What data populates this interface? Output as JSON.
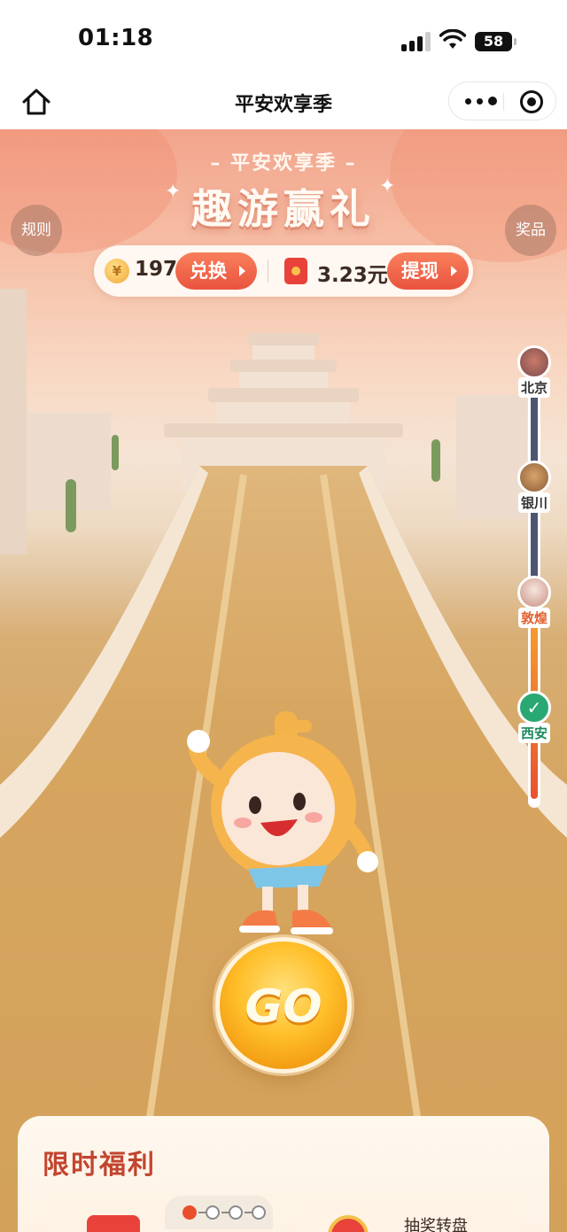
{
  "status_bar": {
    "time": "01:18",
    "battery": "58"
  },
  "nav": {
    "title": "平安欢享季"
  },
  "banner": {
    "subtitle": "– 平安欢享季 –",
    "title": "趣游赢礼"
  },
  "side_buttons": {
    "rules": "规则",
    "prizes": "奖品"
  },
  "balance": {
    "coin_symbol": "¥",
    "coins": "197",
    "exchange_label": "兑换",
    "cash": "3.23元",
    "withdraw_label": "提现"
  },
  "route": {
    "cities": [
      {
        "name": "北京",
        "state": "upcoming"
      },
      {
        "name": "银川",
        "state": "upcoming"
      },
      {
        "name": "敦煌",
        "state": "current"
      },
      {
        "name": "西安",
        "state": "completed"
      }
    ]
  },
  "go_button": {
    "label": "GO"
  },
  "benefits": {
    "title": "限时福利",
    "card_text": "抽奖转盘"
  },
  "colors": {
    "accent": "#e9533f",
    "title_red": "#c2452f",
    "gold": "#f2a93a",
    "route_dark": "#4d5671"
  }
}
